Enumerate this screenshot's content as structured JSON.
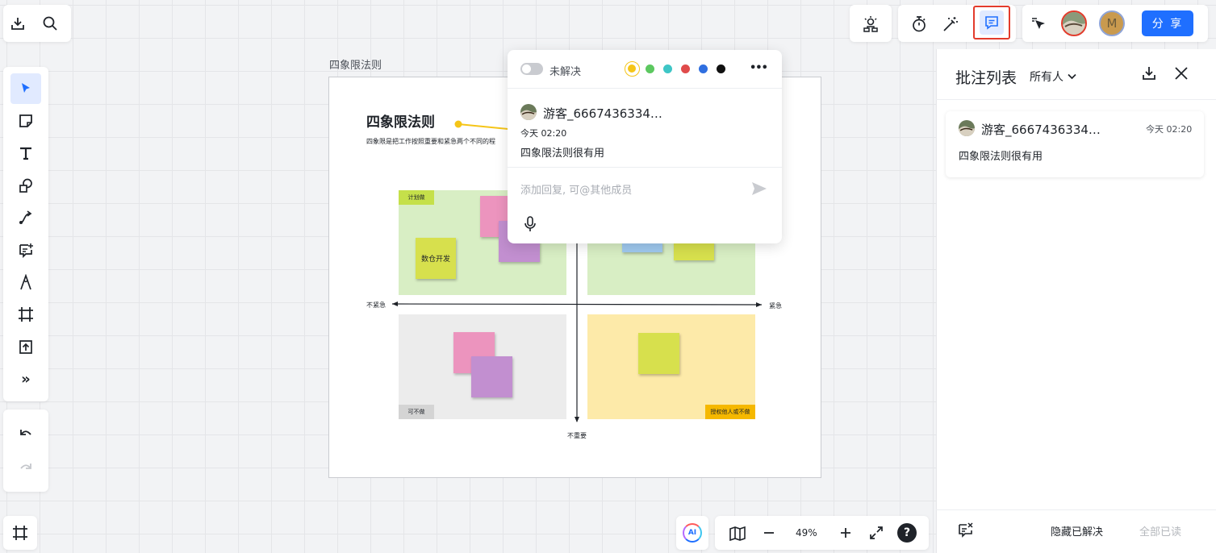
{
  "top_left": {
    "download_icon": "download-icon",
    "search_icon": "search-icon"
  },
  "top_right": {
    "share_label": "分 享",
    "avatar_m_letter": "M"
  },
  "left_toolbar": {
    "tools": [
      "select-cursor-icon",
      "sticky-note-icon",
      "text-tool-icon",
      "shape-tool-icon",
      "connector-icon",
      "comment-add-icon",
      "pen-tool-icon",
      "frame-tool-icon",
      "upload-icon",
      "more-tools-icon"
    ],
    "more_label": "»"
  },
  "board": {
    "frame_label": "四象限法则",
    "title": "四象限法则",
    "subtitle": "四象限是把工作按照重要和紧急两个不同的程",
    "tag_plan": "计划做",
    "tag_maybe": "可不做",
    "tag_delegate": "授权他人或不做",
    "sticky_text": "数仓开发",
    "axis_left": "不紧急",
    "axis_right": "紧急",
    "axis_bottom": "不重要",
    "colors": {
      "plan": "#d8eec4",
      "maybe": "#ececec",
      "delegate": "#fdeaa9",
      "urgent": "#d8eec4"
    }
  },
  "popup": {
    "status_label": "未解决",
    "colors": [
      "#f5c518",
      "#5cc860",
      "#3ec6c6",
      "#e04b4b",
      "#2f6fe0",
      "#111111"
    ],
    "more": "•••",
    "author": "游客_6667436334…",
    "time": "今天 02:20",
    "content": "四象限法则很有用",
    "reply_placeholder": "添加回复, 可@其他成员"
  },
  "comment_panel": {
    "title": "批注列表",
    "filter": "所有人",
    "card": {
      "author": "游客_6667436334…",
      "time": "今天 02:20",
      "content": "四象限法则很有用"
    },
    "hide_resolved": "隐藏已解决",
    "mark_all_read": "全部已读"
  },
  "zoom": {
    "level": "49%",
    "ai_label": "AI",
    "help": "?"
  }
}
